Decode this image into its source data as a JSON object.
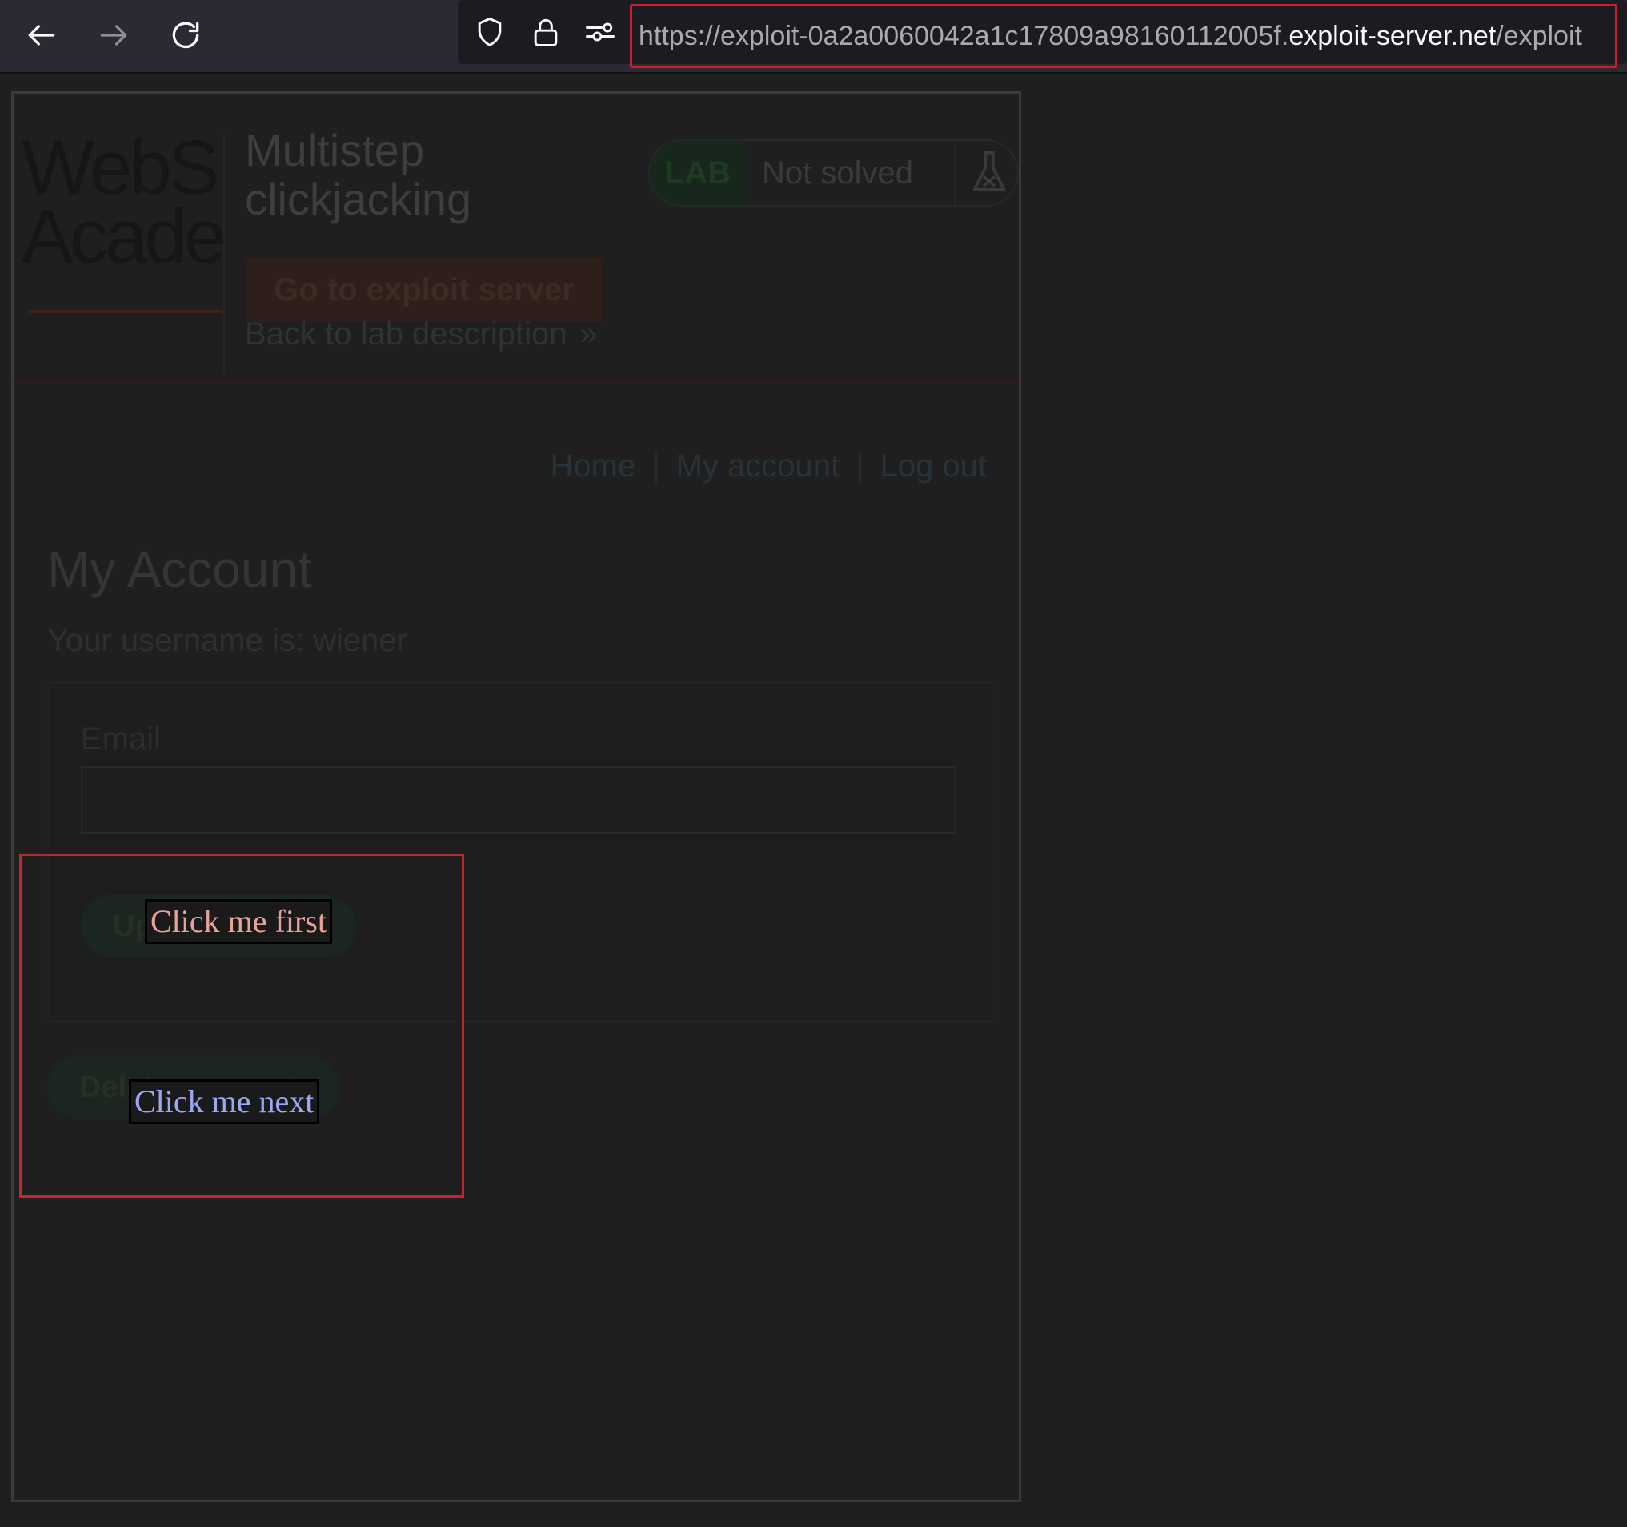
{
  "browser": {
    "url_prefix": "https://exploit-0a2a0060042a1c17809a98160112005f.",
    "url_domain": "exploit-server.net",
    "url_path": "/exploit",
    "icons": [
      "back-arrow-icon",
      "forward-arrow-icon",
      "reload-icon",
      "shield-icon",
      "lock-icon",
      "permissions-icon"
    ]
  },
  "lab": {
    "logo_text_1": "WebS",
    "logo_text_2": "Acade",
    "title": "Multistep clickjacking",
    "badge_label": "LAB",
    "status": "Not solved",
    "exploit_button": "Go to exploit server",
    "back_link": "Back to lab description"
  },
  "nav": {
    "home": "Home",
    "separator": "|",
    "my_account": "My account",
    "log_out": "Log out"
  },
  "account": {
    "heading": "My Account",
    "username_text": "Your username is: wiener",
    "email_label": "Email",
    "update_button": "Update email",
    "delete_button": "Delete account"
  },
  "decoys": {
    "first": "Click me first",
    "next": "Click me next"
  },
  "colors": {
    "highlight": "#c4232f",
    "decoy_first": "#e6a39a",
    "decoy_next": "#9ea8f2"
  }
}
